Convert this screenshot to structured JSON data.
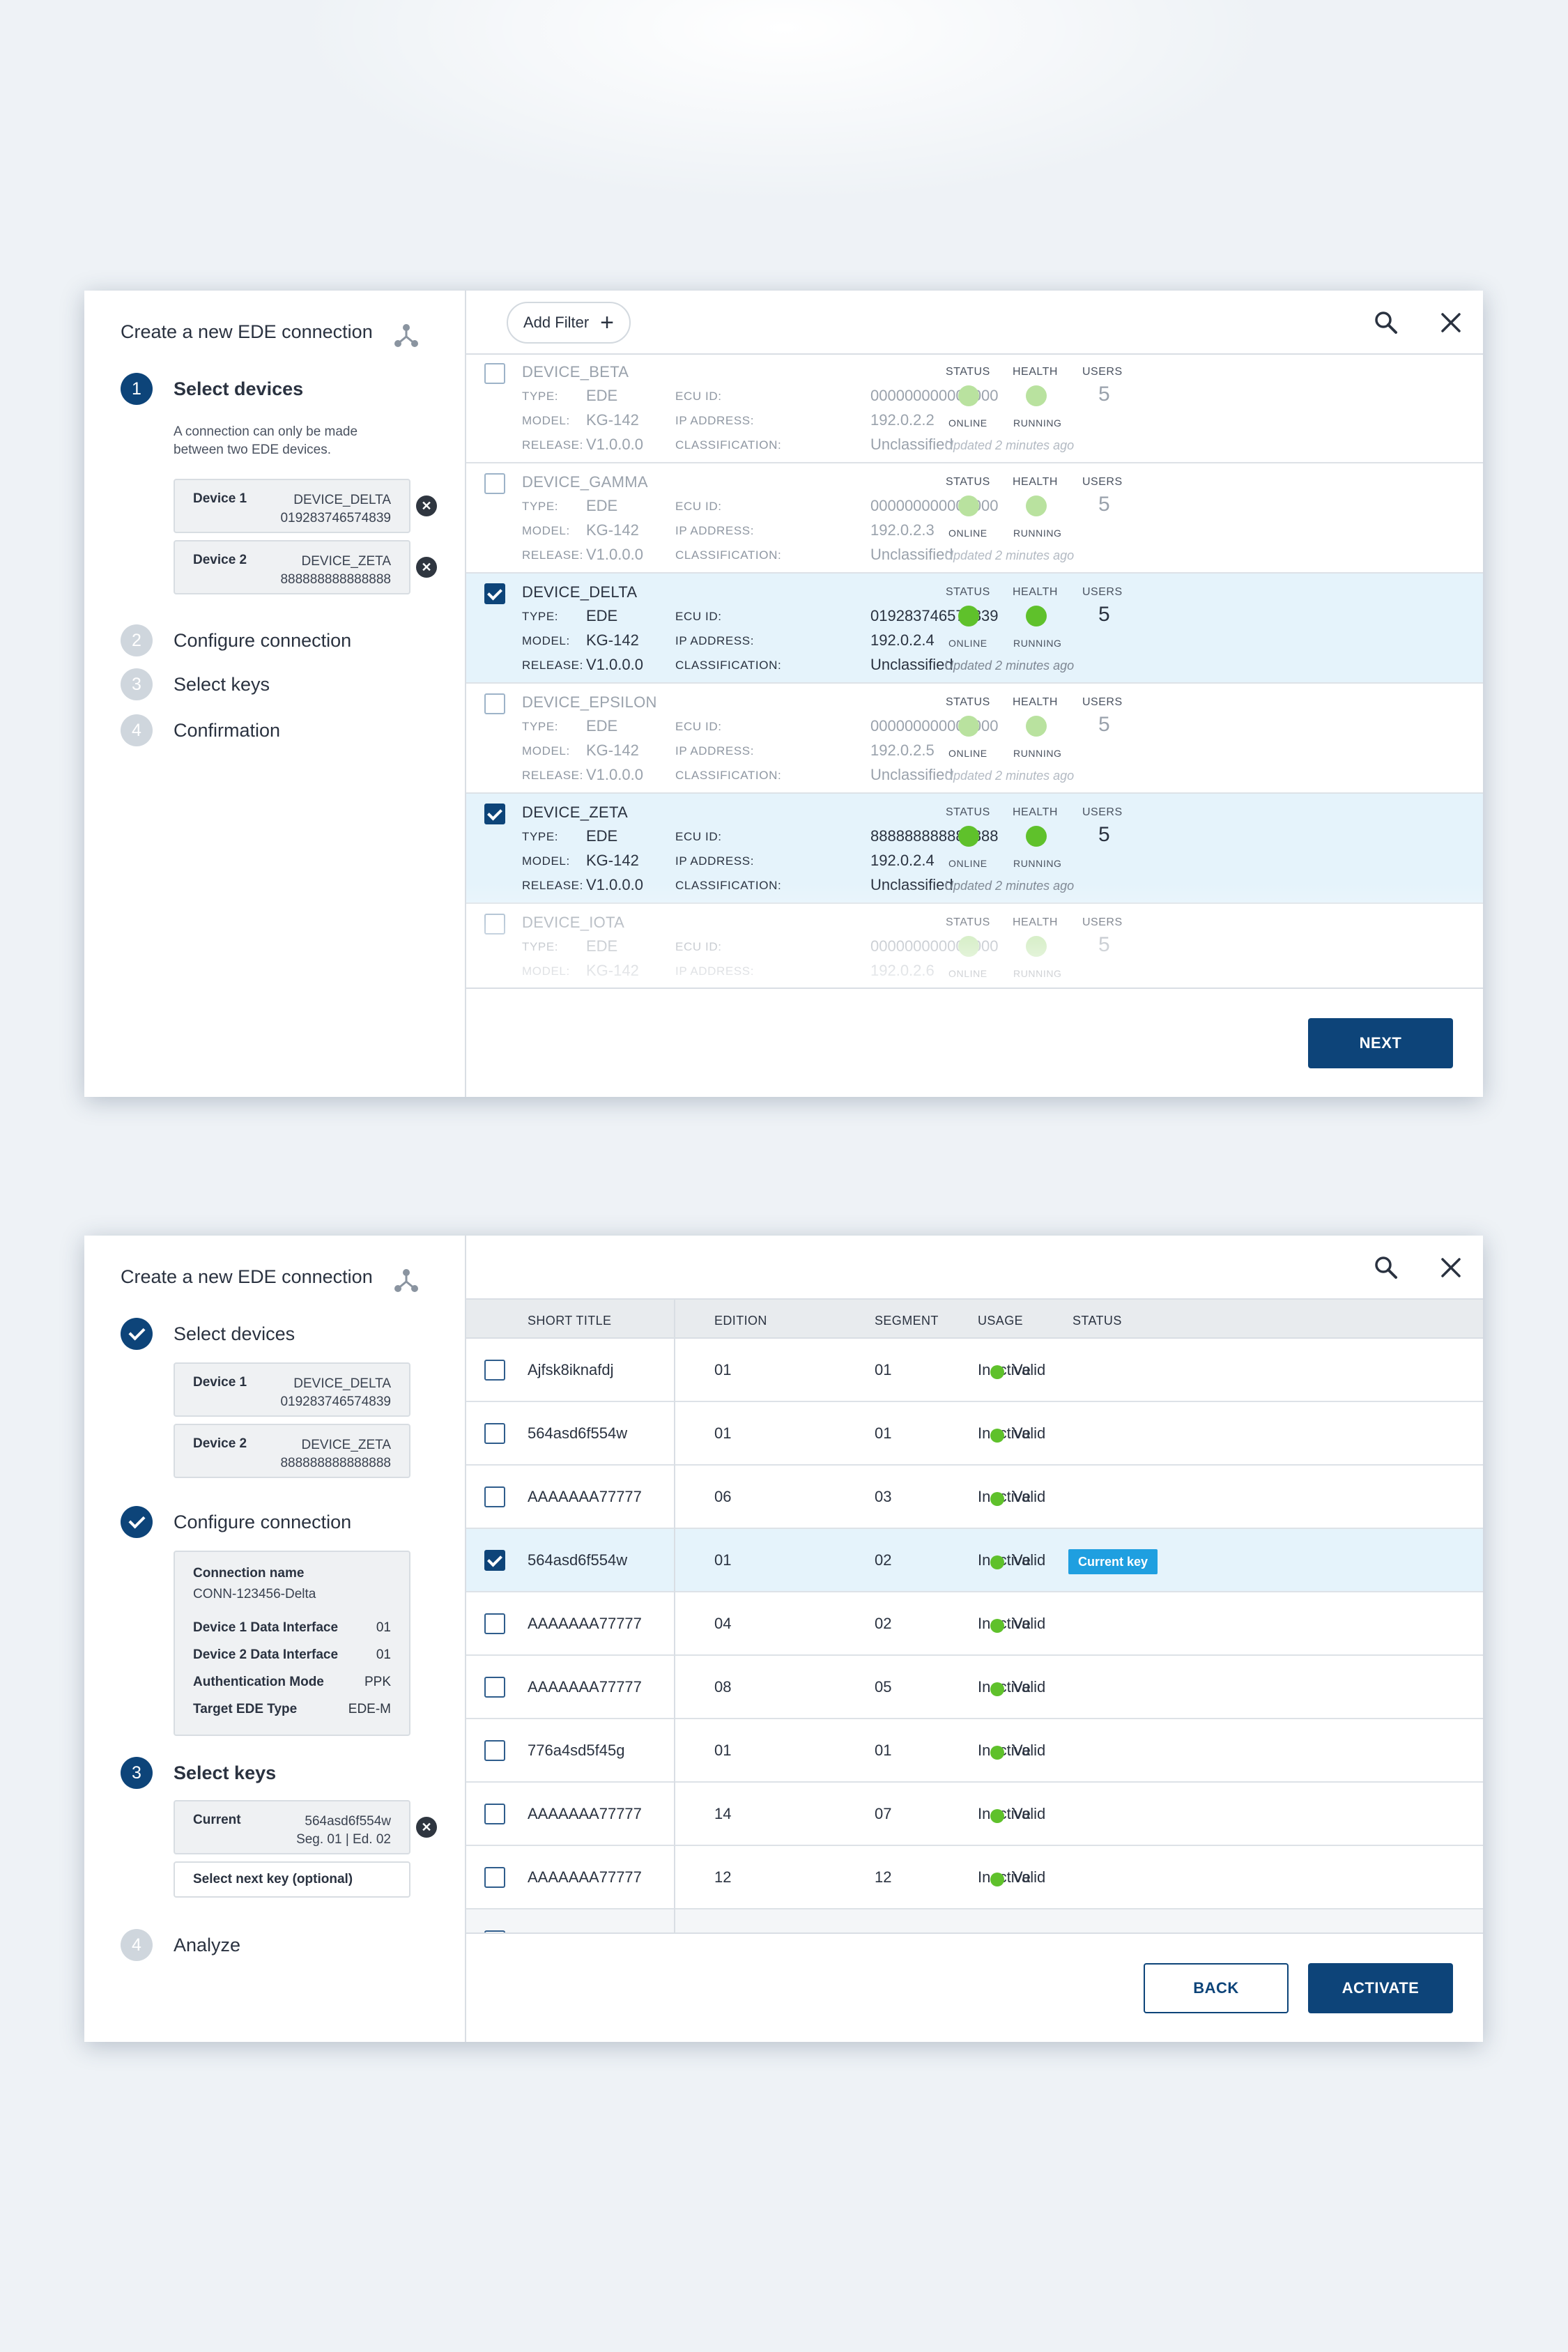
{
  "colors": {
    "primary": "#0d4479",
    "status_green": "#5fc12b",
    "selected_row": "#e5f3fb",
    "badge": "#1f9fe0"
  },
  "icons": {
    "hub": "network-hub-icon",
    "search": "search-icon",
    "close": "close-icon",
    "remove": "remove-circle-icon",
    "check": "checkmark-icon",
    "plus": "plus-icon"
  },
  "panel1": {
    "title": "Create a new EDE connection",
    "steps": [
      {
        "num": "1",
        "label": "Select devices"
      },
      {
        "num": "2",
        "label": "Configure connection"
      },
      {
        "num": "3",
        "label": "Select keys"
      },
      {
        "num": "4",
        "label": "Confirmation"
      }
    ],
    "note": "A connection can only be made between two EDE devices.",
    "selected": [
      {
        "key": "Device 1",
        "name": "DEVICE_DELTA",
        "id": "019283746574839"
      },
      {
        "key": "Device 2",
        "name": "DEVICE_ZETA",
        "id": "888888888888888"
      }
    ],
    "filter_label": "Add Filter",
    "labels": {
      "type": "TYPE:",
      "model": "MODEL:",
      "release": "RELEASE:",
      "ecu": "ECU ID:",
      "ip": "IP ADDRESS:",
      "class": "CLASSIFICATION:",
      "status": "STATUS",
      "health": "HEALTH",
      "users": "USERS",
      "online": "ONLINE",
      "running": "RUNNING"
    },
    "devices": [
      {
        "name": "DEVICE_BETA",
        "type": "EDE",
        "model": "KG-142",
        "release": "V1.0.0.0",
        "ecu": "000000000000000",
        "ip": "192.0.2.2",
        "classification": "Unclassified",
        "users": "5",
        "updated": "Updated 2 minutes ago",
        "checked": false
      },
      {
        "name": "DEVICE_GAMMA",
        "type": "EDE",
        "model": "KG-142",
        "release": "V1.0.0.0",
        "ecu": "000000000000000",
        "ip": "192.0.2.3",
        "classification": "Unclassified",
        "users": "5",
        "updated": "Updated 2 minutes ago",
        "checked": false
      },
      {
        "name": "DEVICE_DELTA",
        "type": "EDE",
        "model": "KG-142",
        "release": "V1.0.0.0",
        "ecu": "019283746574839",
        "ip": "192.0.2.4",
        "classification": "Unclassified",
        "users": "5",
        "updated": "Updated 2 minutes ago",
        "checked": true
      },
      {
        "name": "DEVICE_EPSILON",
        "type": "EDE",
        "model": "KG-142",
        "release": "V1.0.0.0",
        "ecu": "000000000000000",
        "ip": "192.0.2.5",
        "classification": "Unclassified",
        "users": "5",
        "updated": "Updated 2 minutes ago",
        "checked": false
      },
      {
        "name": "DEVICE_ZETA",
        "type": "EDE",
        "model": "KG-142",
        "release": "V1.0.0.0",
        "ecu": "888888888888888",
        "ip": "192.0.2.4",
        "classification": "Unclassified",
        "users": "5",
        "updated": "Updated 2 minutes ago",
        "checked": true
      },
      {
        "name": "DEVICE_IOTA",
        "type": "EDE",
        "model": "KG-142",
        "release": "",
        "ecu": "000000000000000",
        "ip": "192.0.2.6",
        "classification": "",
        "users": "5",
        "updated": "",
        "checked": false
      }
    ],
    "next_label": "NEXT"
  },
  "panel2": {
    "title": "Create a new EDE connection",
    "steps": [
      {
        "num": "",
        "label": "Select devices"
      },
      {
        "num": "",
        "label": "Configure connection"
      },
      {
        "num": "3",
        "label": "Select keys"
      },
      {
        "num": "4",
        "label": "Analyze"
      }
    ],
    "selected": [
      {
        "key": "Device 1",
        "name": "DEVICE_DELTA",
        "id": "019283746574839"
      },
      {
        "key": "Device 2",
        "name": "DEVICE_ZETA",
        "id": "888888888888888"
      }
    ],
    "config": {
      "name_label": "Connection name",
      "name_value": "CONN-123456-Delta",
      "rows": [
        {
          "k": "Device 1 Data Interface",
          "v": "01"
        },
        {
          "k": "Device 2 Data Interface",
          "v": "01"
        },
        {
          "k": "Authentication Mode",
          "v": "PPK"
        },
        {
          "k": "Target EDE Type",
          "v": "EDE-M"
        }
      ]
    },
    "current_key": {
      "label": "Current",
      "name": "564asd6f554w",
      "seg": "Seg. 01 | Ed. 02"
    },
    "next_key_placeholder": "Select next key (optional)",
    "columns": [
      "SHORT TITLE",
      "EDITION",
      "SEGMENT",
      "USAGE",
      "STATUS"
    ],
    "keys": [
      {
        "title": "Ajfsk8iknafdj",
        "edition": "01",
        "segment": "01",
        "usage": "Inactive",
        "status": "Valid",
        "checked": false
      },
      {
        "title": "564asd6f554w",
        "edition": "01",
        "segment": "01",
        "usage": "Inactive",
        "status": "Valid",
        "checked": false
      },
      {
        "title": "AAAAAAA77777",
        "edition": "06",
        "segment": "03",
        "usage": "Inactive",
        "status": "Valid",
        "checked": false
      },
      {
        "title": "564asd6f554w",
        "edition": "01",
        "segment": "02",
        "usage": "Inactive",
        "status": "Valid",
        "checked": true,
        "badge": "Current key"
      },
      {
        "title": "AAAAAAA77777",
        "edition": "04",
        "segment": "02",
        "usage": "Inactive",
        "status": "Valid",
        "checked": false
      },
      {
        "title": "AAAAAAA77777",
        "edition": "08",
        "segment": "05",
        "usage": "Inactive",
        "status": "Valid",
        "checked": false
      },
      {
        "title": "776a4sd5f45g",
        "edition": "01",
        "segment": "01",
        "usage": "Inactive",
        "status": "Valid",
        "checked": false
      },
      {
        "title": "AAAAAAA77777",
        "edition": "14",
        "segment": "07",
        "usage": "Inactive",
        "status": "Valid",
        "checked": false
      },
      {
        "title": "AAAAAAA77777",
        "edition": "12",
        "segment": "12",
        "usage": "Inactive",
        "status": "Valid",
        "checked": false
      }
    ],
    "back_label": "BACK",
    "activate_label": "ACTIVATE"
  }
}
